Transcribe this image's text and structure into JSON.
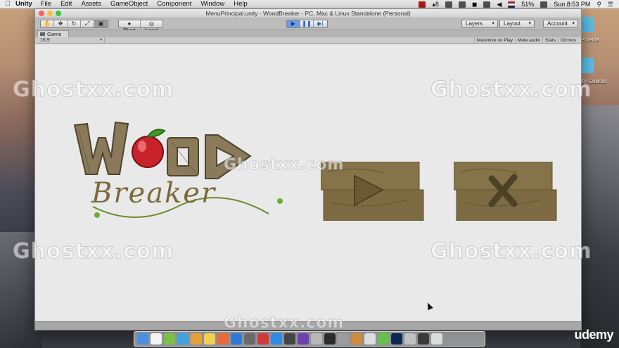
{
  "menubar": {
    "app": "Unity",
    "menus": [
      "File",
      "Edit",
      "Assets",
      "GameObject",
      "Component",
      "Window",
      "Help"
    ],
    "battery": "51%",
    "clock": "Sun 8:53 PM",
    "badge": "8"
  },
  "desktop": {
    "labels": [
      "ements",
      "ity Course"
    ]
  },
  "window": {
    "title": "MenuPrincipal.unity - WoodBreaker - PC, Mac & Linux Standalone (Personal)",
    "toolbar": {
      "pivot_label": "Pivot",
      "local_label": "Local",
      "layers_label": "Layers",
      "layout_label": "Layout",
      "account_label": "Account"
    },
    "tab_label": "Game",
    "aspect_label": "16:9",
    "game_options": [
      "Maximize on Play",
      "Mute audio",
      "Stats",
      "Gizmos"
    ]
  },
  "game": {
    "logo_title": "WOOD",
    "logo_subtitle": "Breaker"
  },
  "watermarks": [
    "Ghostxx.com",
    "Ghostxx.com",
    "Ghostxx.com",
    "Ghostxx.com",
    "Ghostxx.com",
    "Ghostxx.com"
  ],
  "branding": {
    "udemy": "udemy"
  }
}
